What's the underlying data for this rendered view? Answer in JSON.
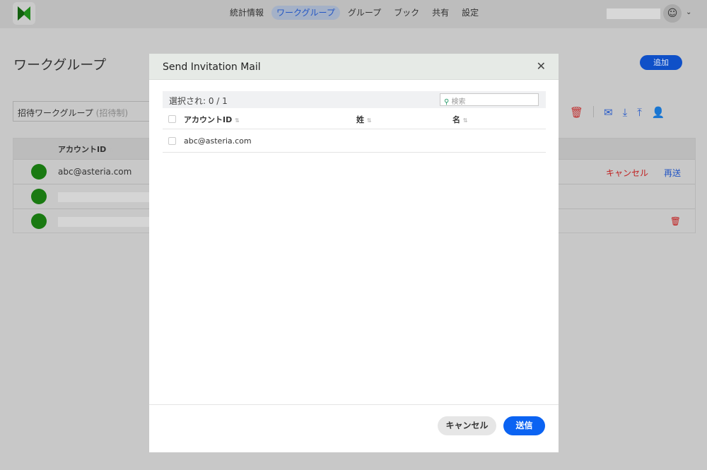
{
  "nav": {
    "items": [
      "統計情報",
      "ワークグループ",
      "グループ",
      "ブック",
      "共有",
      "設定"
    ],
    "active": 1
  },
  "page": {
    "title": "ワークグループ",
    "add_label": "追加",
    "select_value": "招待ワークグループ",
    "select_sub": "(招待制)",
    "col_account": "アカウントID",
    "row1_email": "abc@asteria.com",
    "row1_cancel": "キャンセル",
    "row1_resend": "再送"
  },
  "modal": {
    "title": "Send Invitation Mail",
    "close": "✕",
    "selected": "選択され: 0 / 1",
    "search_placeholder": "検索",
    "cols": [
      "アカウントID",
      "姓",
      "名"
    ],
    "rows": [
      {
        "account": "abc@asteria.com"
      }
    ],
    "cancel": "キャンセル",
    "send": "送信"
  },
  "colors": {
    "accent": "#0b63f2",
    "danger": "#c02020"
  }
}
